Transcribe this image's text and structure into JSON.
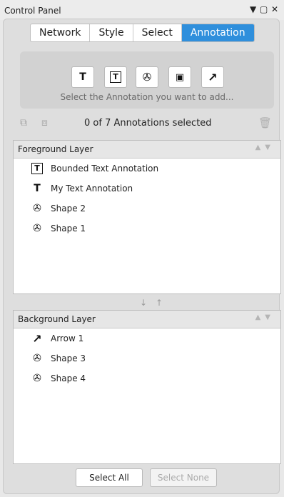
{
  "window": {
    "title": "Control Panel"
  },
  "tabs": [
    {
      "label": "Network"
    },
    {
      "label": "Style"
    },
    {
      "label": "Select"
    },
    {
      "label": "Annotation"
    }
  ],
  "toolbox": {
    "hint": "Select the Annotation you want to add...",
    "tools": [
      {
        "icon": "text-icon",
        "glyph": "T"
      },
      {
        "icon": "bounded-text-icon",
        "glyph": "T"
      },
      {
        "icon": "shape-icon",
        "glyph": "✇"
      },
      {
        "icon": "image-icon",
        "glyph": "▭"
      },
      {
        "icon": "arrow-icon",
        "glyph": "↗"
      }
    ]
  },
  "selection": {
    "status": "0 of 7 Annotations selected"
  },
  "foreground": {
    "title": "Foreground Layer",
    "items": [
      {
        "icon": "bounded-text-icon",
        "label": "Bounded Text Annotation"
      },
      {
        "icon": "text-icon",
        "label": "My Text Annotation"
      },
      {
        "icon": "shape-icon",
        "label": "Shape 2"
      },
      {
        "icon": "shape-icon",
        "label": "Shape 1"
      }
    ]
  },
  "background": {
    "title": "Background Layer",
    "items": [
      {
        "icon": "arrow-icon",
        "label": "Arrow 1"
      },
      {
        "icon": "shape-icon",
        "label": "Shape 3"
      },
      {
        "icon": "shape-icon",
        "label": "Shape 4"
      }
    ]
  },
  "buttons": {
    "select_all": "Select All",
    "select_none": "Select None"
  },
  "colors": {
    "active_tab": "#2f8fdc"
  }
}
